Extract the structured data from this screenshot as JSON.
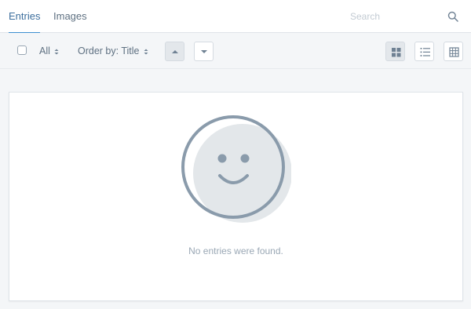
{
  "tabs": [
    {
      "label": "Entries",
      "active": true
    },
    {
      "label": "Images",
      "active": false
    }
  ],
  "search": {
    "placeholder": "Search",
    "icon": "search-icon"
  },
  "toolbar": {
    "filter_label": "All",
    "order_label": "Order by: Title",
    "sort_direction": "ascending",
    "view_mode": "grid"
  },
  "empty_state": {
    "message": "No entries were found."
  },
  "colors": {
    "accent": "#3d8fd0",
    "icon": "#8a9bab",
    "face_fill": "#e3e7ea",
    "text_muted": "#9aa8b5"
  }
}
